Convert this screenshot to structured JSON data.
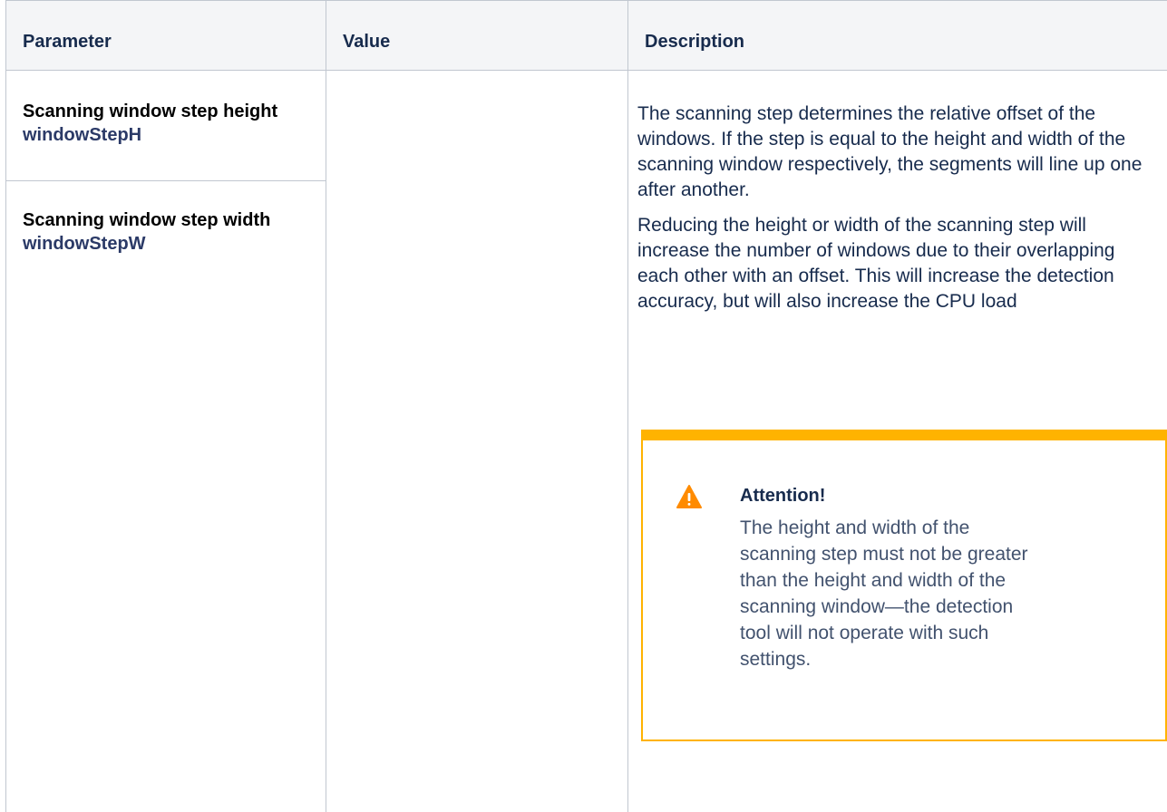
{
  "table": {
    "headers": {
      "parameter": "Parameter",
      "value": "Value",
      "description": "Description"
    },
    "rows": [
      {
        "name": "Scanning window step height",
        "code": "windowStepH"
      },
      {
        "name": "Scanning window step width",
        "code": "windowStepW"
      }
    ],
    "description": {
      "paragraphs": [
        "The scanning step determines the relative offset of the windows. If the step is equal to the height and width of the scanning window respectively, the segments will line up one after another.",
        "Reducing the height or width of the scanning step will increase the number of windows due to their overlapping each other with an offset. This will increase the detection accuracy, but will also increase the CPU load"
      ],
      "panel": {
        "icon": "warning-icon",
        "title": "Attention!",
        "body": "The height and width of the scanning step must not be greater than the height and width of the scanning window—the detection tool will not operate with such settings.",
        "accent_color": "#ffb300",
        "icon_color": "#ff8b00"
      }
    }
  }
}
